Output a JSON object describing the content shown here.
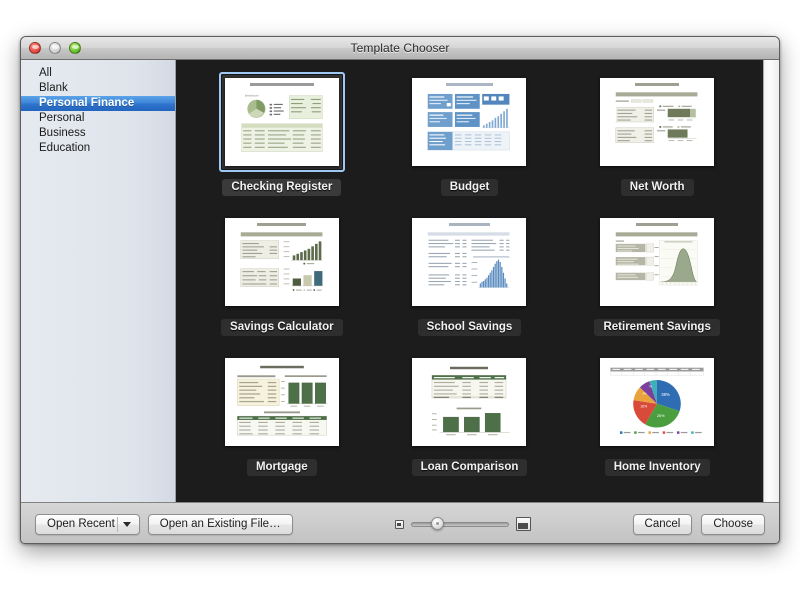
{
  "window": {
    "title": "Template Chooser",
    "controls": {
      "close": "close-button",
      "minimize": "minimize-button",
      "zoom": "zoom-button"
    }
  },
  "sidebar": {
    "items": [
      {
        "label": "All",
        "selected": false
      },
      {
        "label": "Blank",
        "selected": false
      },
      {
        "label": "Personal Finance",
        "selected": true
      },
      {
        "label": "Personal",
        "selected": false
      },
      {
        "label": "Business",
        "selected": false
      },
      {
        "label": "Education",
        "selected": false
      }
    ]
  },
  "templates": [
    {
      "label": "Checking Register",
      "selected": true,
      "theme": "green",
      "art": "pie-table"
    },
    {
      "label": "Budget",
      "selected": false,
      "theme": "blue",
      "art": "panels-bars"
    },
    {
      "label": "Net Worth",
      "selected": false,
      "theme": "olive",
      "art": "hbars"
    },
    {
      "label": "Savings Calculator",
      "selected": false,
      "theme": "olive",
      "art": "bars-compare"
    },
    {
      "label": "School Savings",
      "selected": false,
      "theme": "blue",
      "art": "curve-bars"
    },
    {
      "label": "Retirement Savings",
      "selected": false,
      "theme": "olive",
      "art": "area-curve"
    },
    {
      "label": "Mortgage",
      "selected": false,
      "theme": "green",
      "art": "three-bars-table"
    },
    {
      "label": "Loan Comparison",
      "selected": false,
      "theme": "green",
      "art": "table-three-bars"
    },
    {
      "label": "Home Inventory",
      "selected": false,
      "theme": "multi",
      "art": "pie-legend"
    }
  ],
  "toolbar": {
    "open_recent_label": "Open Recent",
    "open_existing_label": "Open an Existing File…",
    "cancel_label": "Cancel",
    "choose_label": "Choose",
    "slider": {
      "small_icon": "small-thumbnail-icon",
      "large_icon": "large-thumbnail-icon",
      "value_percent": 27
    }
  },
  "colors": {
    "selection_blue": "#2f75cd",
    "content_background": "#1c1c1c",
    "sidebar_background": "#e2e7ef",
    "green_accent": "#4d7049",
    "blue_accent": "#4b86c4",
    "olive_accent": "#777f64"
  }
}
